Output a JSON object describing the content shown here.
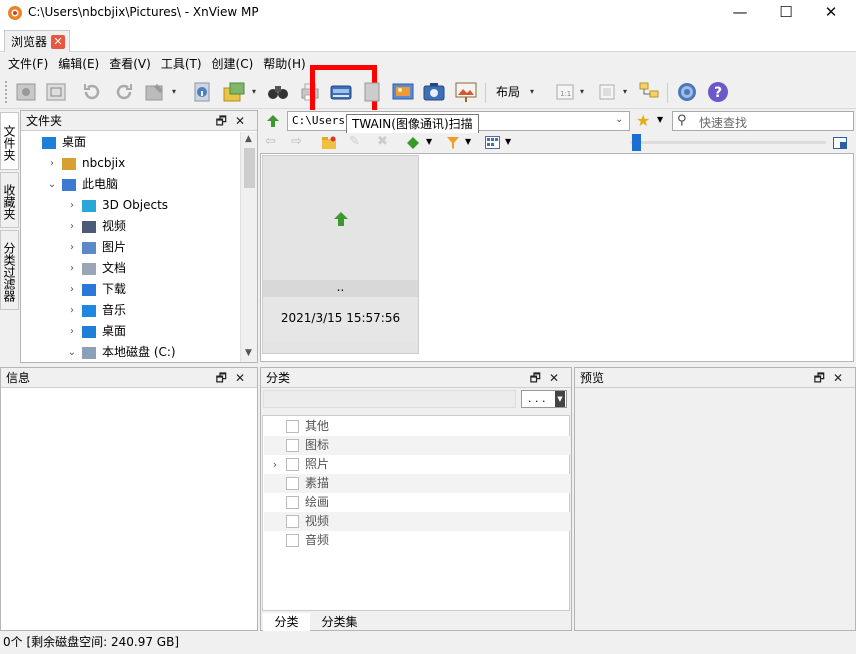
{
  "window": {
    "title": "C:\\Users\\nbcbjix\\Pictures\\ - XnView MP",
    "minimize_glyph": "—",
    "maximize_glyph": "☐",
    "close_glyph": "✕"
  },
  "tabs": [
    {
      "label": "浏览器",
      "close_glyph": "✕"
    }
  ],
  "menu": [
    "文件(F)",
    "编辑(E)",
    "查看(V)",
    "工具(T)",
    "创建(C)",
    "帮助(H)"
  ],
  "toolbar": {
    "layout_label": "布局",
    "tooltip": "TWAIN(图像通讯)扫描",
    "highlight_color": "#ff0000"
  },
  "addressbar": {
    "path": "C:\\Users\\n",
    "quick_search_placeholder": "快速查找"
  },
  "left_tabs": [
    "文件夹",
    "收藏夹",
    "分类过滤器"
  ],
  "folders_panel": {
    "title": "文件夹",
    "items": [
      {
        "label": "桌面",
        "icon": "desktop-icon",
        "chevron": ""
      },
      {
        "label": "nbcbjix",
        "icon": "user-icon",
        "chevron": "›"
      },
      {
        "label": "此电脑",
        "icon": "pc-icon",
        "chevron": "⌄"
      },
      {
        "label": "3D Objects",
        "icon": "3d-objects-icon",
        "chevron": "›"
      },
      {
        "label": "视频",
        "icon": "video-folder-icon",
        "chevron": "›"
      },
      {
        "label": "图片",
        "icon": "pictures-folder-icon",
        "chevron": "›"
      },
      {
        "label": "文档",
        "icon": "documents-folder-icon",
        "chevron": "›"
      },
      {
        "label": "下载",
        "icon": "downloads-folder-icon",
        "chevron": "›"
      },
      {
        "label": "音乐",
        "icon": "music-folder-icon",
        "chevron": "›"
      },
      {
        "label": "桌面",
        "icon": "desktop-icon",
        "chevron": "›"
      },
      {
        "label": "本地磁盘 (C:)",
        "icon": "drive-icon",
        "chevron": "⌄"
      }
    ]
  },
  "thumbnail": {
    "name": "..",
    "date": "2021/3/15 15:57:56"
  },
  "info_panel": {
    "title": "信息"
  },
  "category_panel": {
    "title": "分类",
    "dropdown_label": ". . .",
    "items": [
      "其他",
      "图标",
      "照片",
      "素描",
      "绘画",
      "视频",
      "音频"
    ],
    "tabs": [
      "分类",
      "分类集"
    ]
  },
  "preview_panel": {
    "title": "预览"
  },
  "status": "0个 [剩余磁盘空间: 240.97 GB]",
  "pane_buttons": {
    "float": "🗗",
    "close": "✕"
  }
}
